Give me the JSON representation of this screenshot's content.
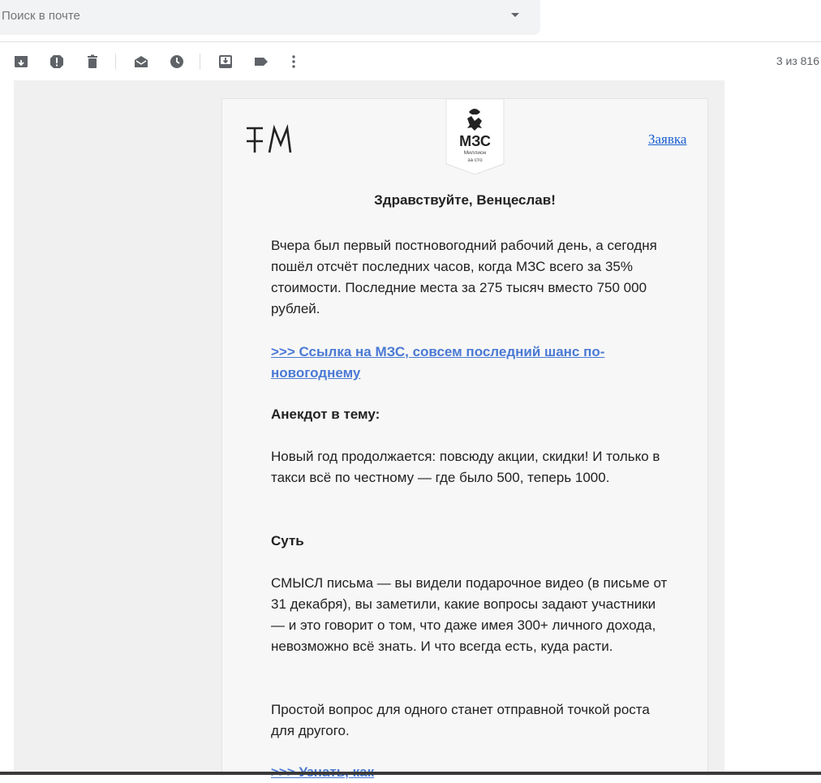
{
  "search": {
    "placeholder": "Поиск в почте"
  },
  "toolbar": {
    "icons": [
      "archive-icon",
      "report-spam-icon",
      "delete-icon",
      "mark-unread-icon",
      "snooze-icon",
      "move-to-icon",
      "label-icon",
      "more-icon"
    ],
    "pager": "3 из 816"
  },
  "email": {
    "logo_left": "FM",
    "badge_title": "МЗС",
    "badge_sub1": "Миллион",
    "badge_sub2": "за сто",
    "apply_link": "Заявка",
    "greeting": "Здравствуйте, Венцеслав!",
    "para1": "Вчера был первый постновогодний рабочий день, а сегодня пошёл отсчёт последних часов, когда МЗС всего за 35% стоимости. Последние места за 275 тысяч вместо 750 000 рублей.",
    "link1": ">>> Ссылка на МЗС, совсем последний шанс по-новогоднему",
    "heading1": "Анекдот в тему:",
    "para2": "Новый год продолжается: повсюду акции, скидки! И только в такси всё по честному — где было 500, теперь 1000.",
    "heading2": "Суть",
    "para3": "СМЫСЛ письма — вы видели подарочное видео (в письме от 31 декабря), вы заметили, какие вопросы задают участники — и это говорит о том, что даже имея 300+ личного дохода, невозможно всё знать. И что всегда есть, куда расти.",
    "para4": "Простой вопрос для одного станет отправной точкой роста для другого.",
    "link2": ">>> Узнать, как"
  }
}
